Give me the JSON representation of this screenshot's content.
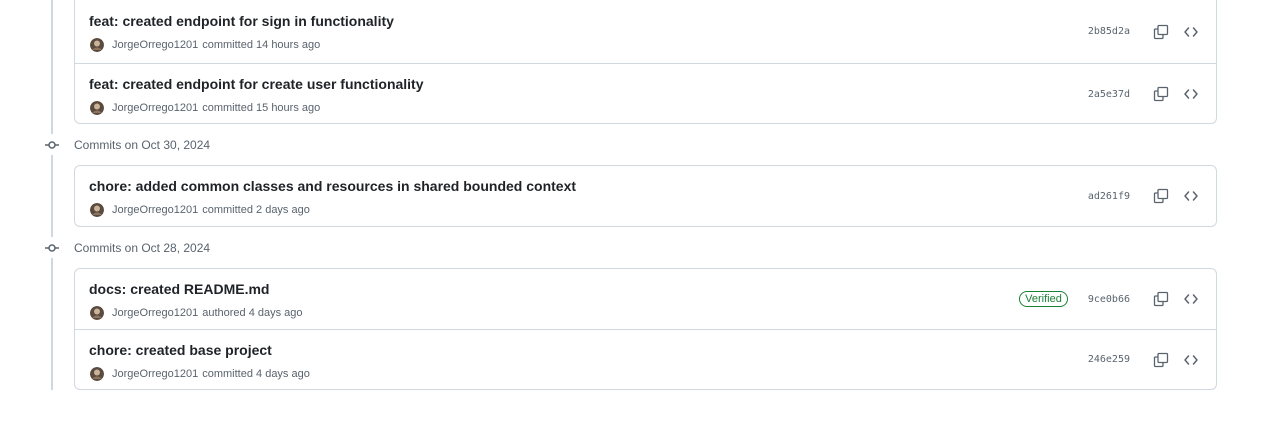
{
  "colors": {
    "text_primary": "#1f2328",
    "text_muted": "#59636e",
    "border": "#d1d9e0",
    "verified_green": "#1a7f37"
  },
  "groups": [
    {
      "label": "",
      "commits": [
        {
          "message": "feat: created endpoint for sign in functionality",
          "author": "JorgeOrrego1201",
          "action": "committed 14 hours ago",
          "sha": "2b85d2a",
          "verified": ""
        },
        {
          "message": "feat: created endpoint for create user functionality",
          "author": "JorgeOrrego1201",
          "action": "committed 15 hours ago",
          "sha": "2a5e37d",
          "verified": ""
        }
      ]
    },
    {
      "label": "Commits on Oct 30, 2024",
      "commits": [
        {
          "message": "chore: added common classes and resources in shared bounded context",
          "author": "JorgeOrrego1201",
          "action": "committed 2 days ago",
          "sha": "ad261f9",
          "verified": ""
        }
      ]
    },
    {
      "label": "Commits on Oct 28, 2024",
      "commits": [
        {
          "message": "docs: created README.md",
          "author": "JorgeOrrego1201",
          "action": "authored 4 days ago",
          "sha": "9ce0b66",
          "verified": "Verified"
        },
        {
          "message": "chore: created base project",
          "author": "JorgeOrrego1201",
          "action": "committed 4 days ago",
          "sha": "246e259",
          "verified": ""
        }
      ]
    }
  ],
  "icons": {
    "commit": "git-commit-icon",
    "copy": "copy-icon",
    "browse": "code-icon",
    "avatar": "avatar"
  }
}
